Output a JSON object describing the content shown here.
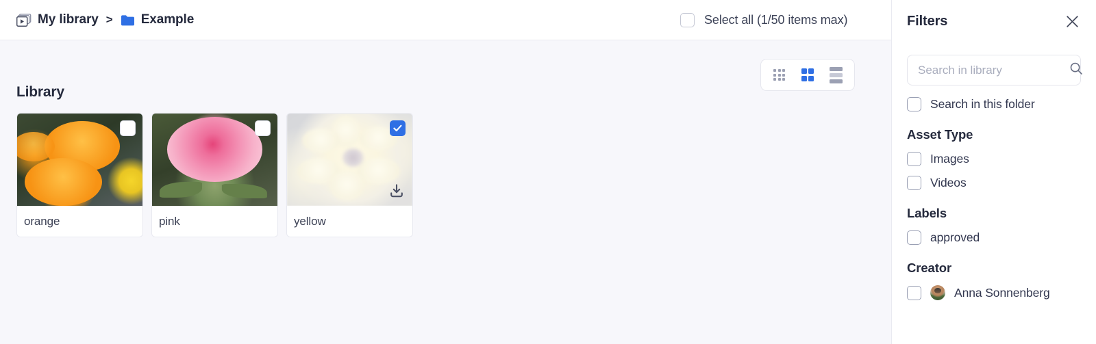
{
  "topbar": {
    "breadcrumb": {
      "library_icon": "media-library-icon",
      "root_label": "My library",
      "separator": ">",
      "folder_icon": "folder-icon",
      "folder_label": "Example"
    },
    "select_all_label": "Select all (1/50 items max)",
    "select_all_checked": false
  },
  "view_toggle": {
    "options": [
      {
        "id": "small-grid",
        "icon": "grid-small-icon",
        "active": false
      },
      {
        "id": "large-grid",
        "icon": "grid-large-icon",
        "active": true
      },
      {
        "id": "list",
        "icon": "list-view-icon",
        "active": false
      }
    ],
    "active_color": "#2f6fe4",
    "inactive_color": "#9ba0b3"
  },
  "main": {
    "section_title": "Library",
    "cards": [
      {
        "label": "orange",
        "selected": false,
        "has_download": false
      },
      {
        "label": "pink",
        "selected": false,
        "has_download": false
      },
      {
        "label": "yellow",
        "selected": true,
        "has_download": true
      }
    ]
  },
  "filters": {
    "title": "Filters",
    "close_icon": "close-icon",
    "search": {
      "placeholder": "Search in library",
      "value": "",
      "icon": "search-icon"
    },
    "search_folder": {
      "label": "Search in this folder",
      "checked": false
    },
    "groups": [
      {
        "title": "Asset Type",
        "options": [
          {
            "label": "Images",
            "checked": false
          },
          {
            "label": "Videos",
            "checked": false
          }
        ]
      },
      {
        "title": "Labels",
        "options": [
          {
            "label": "approved",
            "checked": false
          }
        ]
      },
      {
        "title": "Creator",
        "options": [
          {
            "label": "Anna Sonnenberg",
            "checked": false,
            "avatar": "user-avatar"
          }
        ]
      }
    ]
  },
  "colors": {
    "accent": "#2f6fe4",
    "page_bg": "#f7f7fb",
    "panel_bg": "#ffffff",
    "text_dark": "#252a3d",
    "border": "#e7e8ef"
  }
}
